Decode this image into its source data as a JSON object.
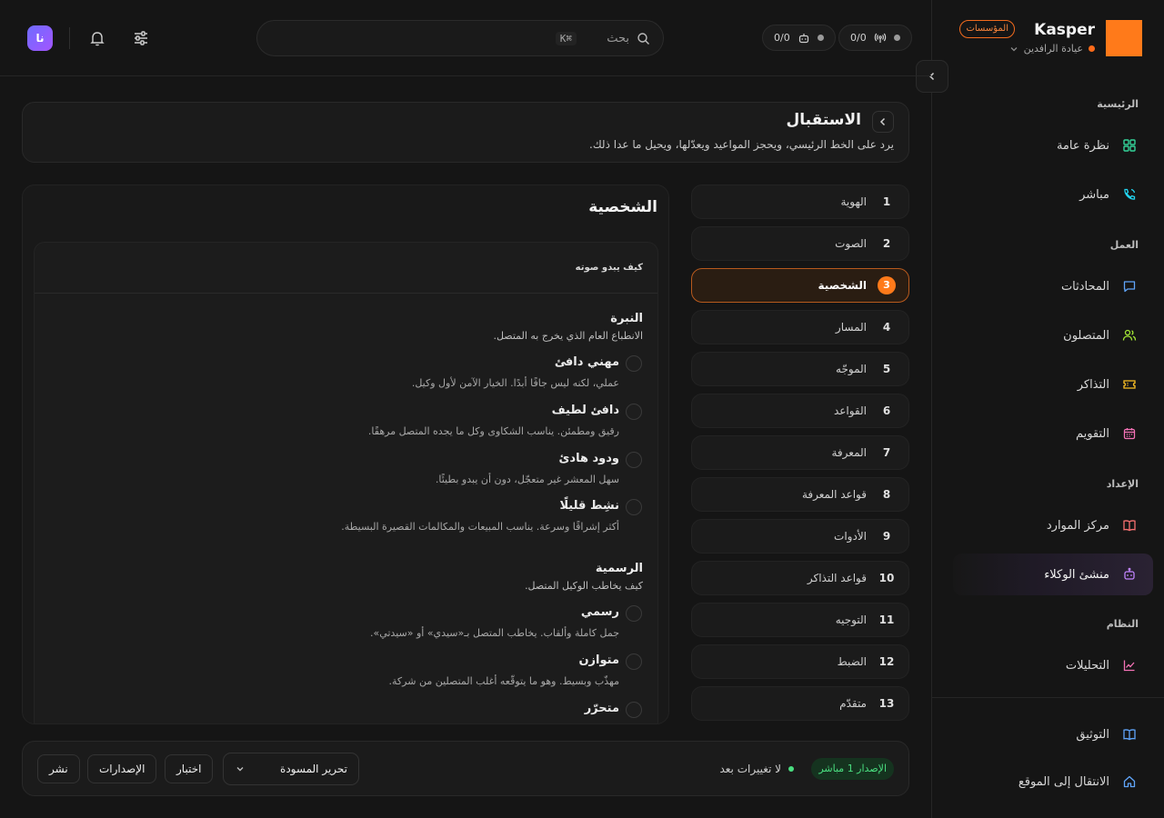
{
  "brand": {
    "name": "Kasper",
    "tag": "المؤسسات",
    "org": "عيادة الرافدين"
  },
  "nav": {
    "sections": [
      {
        "title": "الرئيسية",
        "items": [
          {
            "label": "نظرة عامة",
            "icon": "grid-icon"
          },
          {
            "label": "مباشر",
            "icon": "phone-icon"
          }
        ]
      },
      {
        "title": "العمل",
        "items": [
          {
            "label": "المحادثات",
            "icon": "chat-icon"
          },
          {
            "label": "المتصلون",
            "icon": "users-icon"
          },
          {
            "label": "التذاكر",
            "icon": "ticket-icon"
          },
          {
            "label": "التقويم",
            "icon": "calendar-icon"
          }
        ]
      },
      {
        "title": "الإعداد",
        "items": [
          {
            "label": "مركز الموارد",
            "icon": "book-icon"
          },
          {
            "label": "منشئ الوكلاء",
            "icon": "bot-icon",
            "active": true
          }
        ]
      },
      {
        "title": "النظام",
        "items": [
          {
            "label": "التحليلات",
            "icon": "chart-icon"
          }
        ]
      }
    ],
    "footer": [
      {
        "label": "التوثيق",
        "icon": "book-open-icon"
      },
      {
        "label": "الانتقال إلى الموقع",
        "icon": "home-icon"
      }
    ]
  },
  "topbar": {
    "stat_calls": "0/0",
    "stat_agents": "0/0",
    "search_placeholder": "بحث",
    "search_kbd": "⌘K",
    "avatar": "نا"
  },
  "header": {
    "title": "الاستقبال",
    "description": "يرد على الخط الرئيسي، ويحجز المواعيد ويعدّلها، ويحيل ما عدا ذلك."
  },
  "steps": [
    {
      "num": "1",
      "label": "الهوية"
    },
    {
      "num": "2",
      "label": "الصوت"
    },
    {
      "num": "3",
      "label": "الشخصية",
      "active": true
    },
    {
      "num": "4",
      "label": "المسار"
    },
    {
      "num": "5",
      "label": "الموجّه"
    },
    {
      "num": "6",
      "label": "القواعد"
    },
    {
      "num": "7",
      "label": "المعرفة"
    },
    {
      "num": "8",
      "label": "قواعد المعرفة"
    },
    {
      "num": "9",
      "label": "الأدوات"
    },
    {
      "num": "10",
      "label": "قواعد التذاكر"
    },
    {
      "num": "11",
      "label": "التوجيه"
    },
    {
      "num": "12",
      "label": "الضبط"
    },
    {
      "num": "13",
      "label": "متقدّم"
    }
  ],
  "panel": {
    "title": "الشخصية",
    "card_heading": "كيف يبدو صوته",
    "groups": [
      {
        "title": "النبرة",
        "description": "الانطباع العام الذي يخرج به المتصل.",
        "options": [
          {
            "label": "مهني دافئ",
            "description": "عملي، لكنه ليس جافًا أبدًا. الخيار الآمن لأول وكيل."
          },
          {
            "label": "دافئ لطيف",
            "description": "رقيق ومطمئن. يناسب الشكاوى وكل ما يجده المتصل مرهقًا."
          },
          {
            "label": "ودود هادئ",
            "description": "سهل المعشر غير متعجّل، دون أن يبدو بطيئًا."
          },
          {
            "label": "نشِط قليلًا",
            "description": "أكثر إشراقًا وسرعة. يناسب المبيعات والمكالمات القصيرة البسيطة."
          }
        ]
      },
      {
        "title": "الرسمية",
        "description": "كيف يخاطب الوكيل المتصل.",
        "options": [
          {
            "label": "رسمي",
            "description": "جمل كاملة وألقاب. يخاطب المتصل بـ«سيدي» أو «سيدتي»."
          },
          {
            "label": "متوازن",
            "description": "مهذّب وبسيط. وهو ما يتوقّعه أغلب المتصلين من شركة."
          },
          {
            "label": "متحرّر",
            "description": ""
          }
        ]
      }
    ]
  },
  "bottom": {
    "version_badge": "الإصدار 1 مباشر",
    "status": "لا تغييرات بعد",
    "draft_select": "تحرير المسودة",
    "test_btn": "اختبار",
    "versions_btn": "الإصدارات",
    "publish_btn": "نشر"
  },
  "colors": {
    "accent": "#ff7a1a",
    "success": "#4ade80",
    "agent_accent": "#a855f7"
  }
}
